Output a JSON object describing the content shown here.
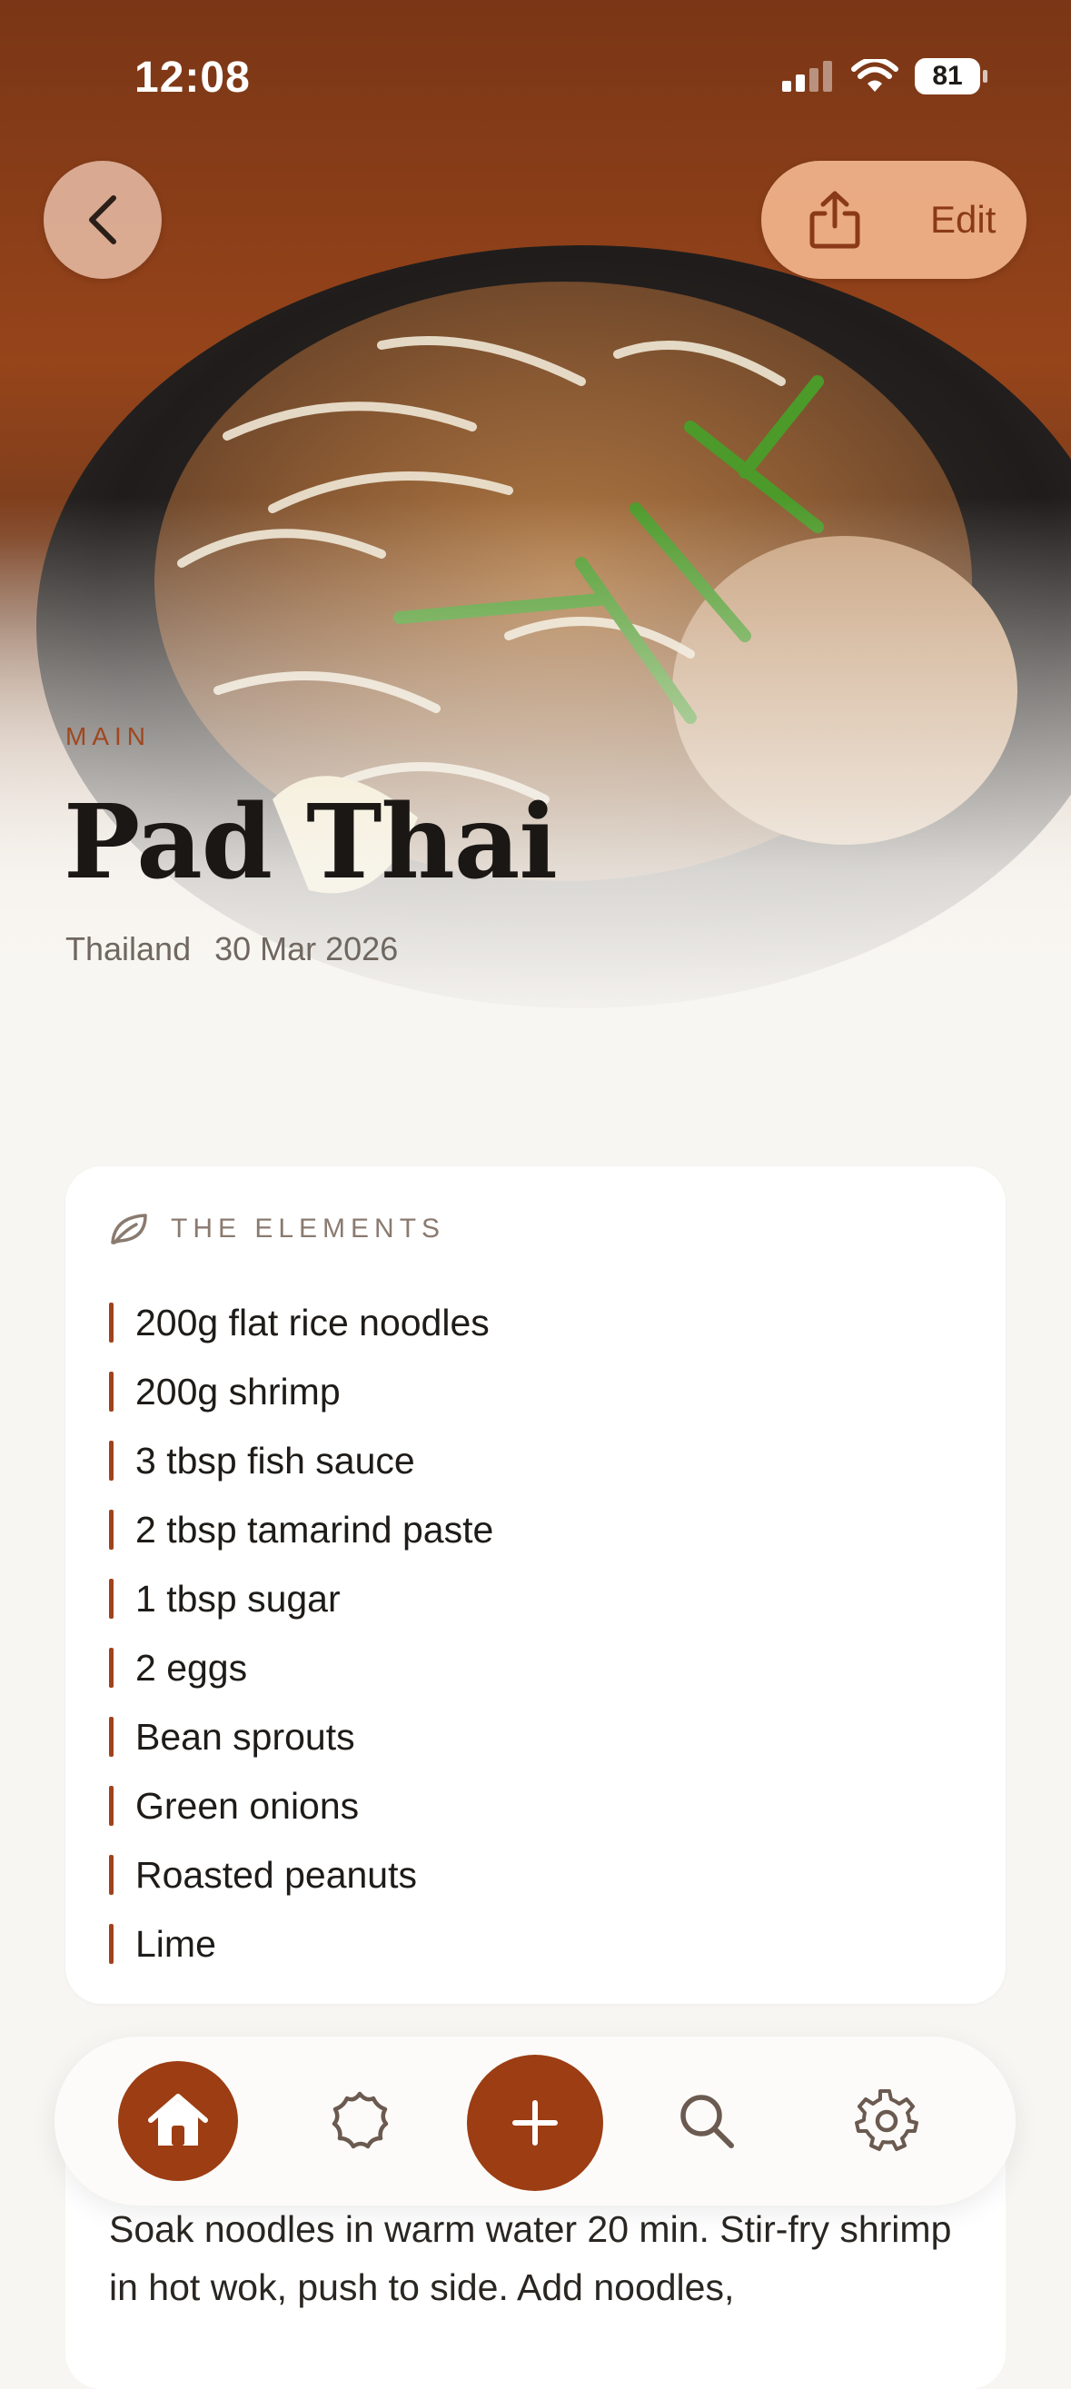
{
  "status_bar": {
    "time": "12:08",
    "battery": "81"
  },
  "header": {
    "edit_label": "Edit"
  },
  "recipe": {
    "category": "MAIN",
    "title": "Pad Thai",
    "origin": "Thailand",
    "date": "30 Mar 2026"
  },
  "ingredients_card": {
    "title": "THE ELEMENTS",
    "items": [
      "200g flat rice noodles",
      "200g shrimp",
      "3 tbsp fish sauce",
      "2 tbsp tamarind paste",
      "1 tbsp sugar",
      "2 eggs",
      "Bean sprouts",
      "Green onions",
      "Roasted peanuts",
      "Lime"
    ]
  },
  "method_card": {
    "text": "Soak noodles in warm water 20 min. Stir-fry shrimp in hot wok, push to side. Add noodles,"
  },
  "tab_bar": {
    "items": [
      "home-icon",
      "elements-icon",
      "plus-icon",
      "search-icon",
      "gear-icon"
    ],
    "active": "home-icon"
  },
  "colors": {
    "accent": "#9c3d13",
    "background": "#f8f6f2",
    "card": "#ffffff"
  }
}
